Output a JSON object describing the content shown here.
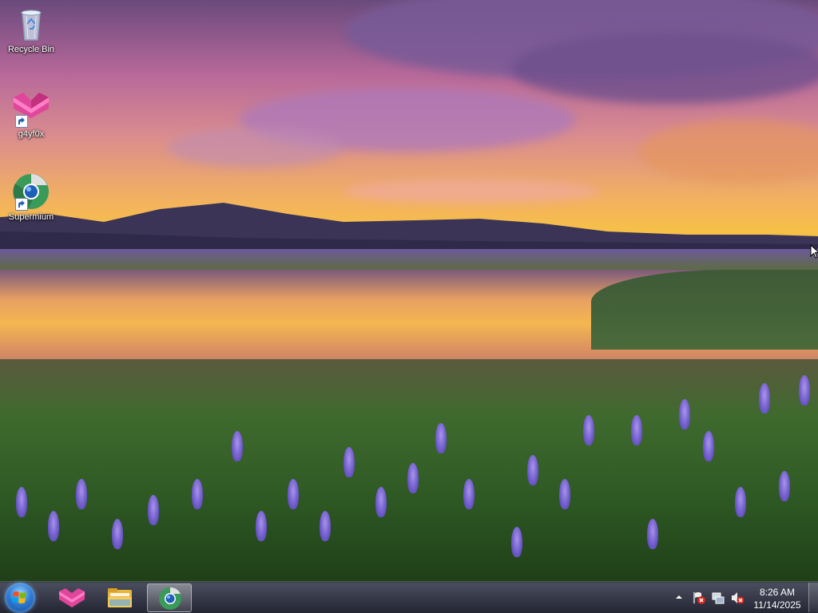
{
  "desktop": {
    "icons": [
      {
        "label": "Recycle Bin",
        "icon": "recycle-bin-icon"
      },
      {
        "label": "g4yf0x",
        "icon": "g4yf0x-app-icon",
        "shortcut": true
      },
      {
        "label": "Supermium",
        "icon": "supermium-browser-icon",
        "shortcut": true
      }
    ]
  },
  "taskbar": {
    "start": {
      "icon": "windows-start-orb-icon"
    },
    "pinned": [
      {
        "icon": "g4yf0x-app-icon",
        "active": false
      },
      {
        "icon": "file-explorer-icon",
        "active": false
      },
      {
        "icon": "supermium-browser-icon",
        "active": true
      }
    ],
    "tray": {
      "icons": [
        "show-hidden-icons-arrow",
        "action-center-flag-icon",
        "network-icon",
        "volume-muted-icon"
      ],
      "time": "8:26 AM",
      "date": "11/14/2025"
    }
  },
  "colors": {
    "accent": "#2b7bd4",
    "tray_alert": "#d9261c"
  }
}
